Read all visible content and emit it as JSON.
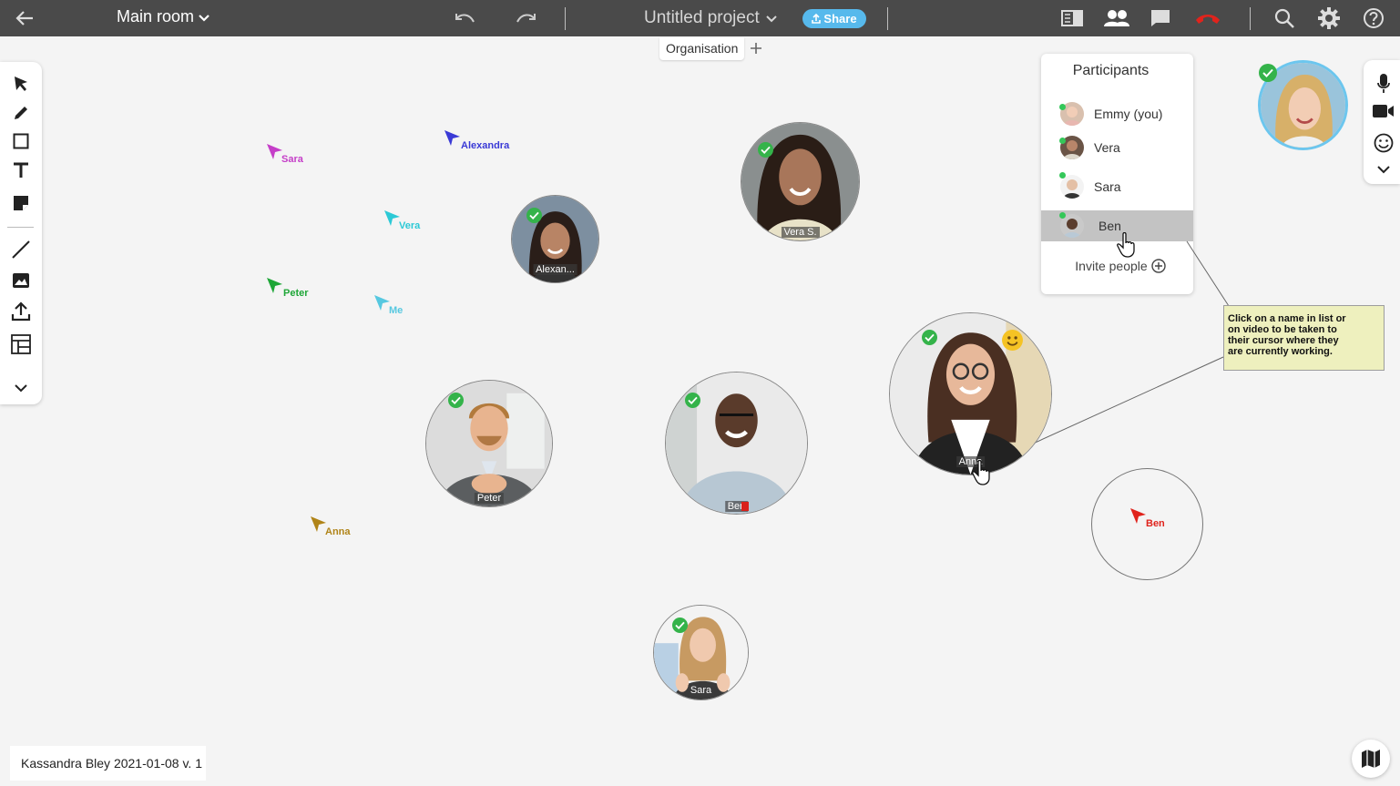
{
  "topbar": {
    "room_title": "Main room",
    "project_title": "Untitled project",
    "share_label": "Share"
  },
  "tabs": [
    {
      "label": "Organisation"
    }
  ],
  "tools": [
    "select-tool",
    "pen-tool",
    "rectangle-tool",
    "text-tool",
    "sticky-note-tool",
    "line-tool",
    "image-tool",
    "upload-tool",
    "template-tool",
    "more-tools"
  ],
  "participants_panel": {
    "title": "Participants",
    "participants": [
      {
        "name": "Emmy (you)",
        "online": true
      },
      {
        "name": "Vera",
        "online": true
      },
      {
        "name": "Sara",
        "online": true
      },
      {
        "name": "Ben",
        "online": true,
        "highlighted": true
      }
    ],
    "invite_label": "Invite people"
  },
  "cursors": [
    {
      "name": "Sara",
      "color": "#c53ec8"
    },
    {
      "name": "Alexandra",
      "color": "#3a3ad6"
    },
    {
      "name": "Vera",
      "color": "#2cc9d6"
    },
    {
      "name": "Peter",
      "color": "#1ea637"
    },
    {
      "name": "Me",
      "color": "#56c8e0"
    },
    {
      "name": "Anna",
      "color": "#b08418"
    },
    {
      "name": "Ben",
      "color": "#e0231c"
    }
  ],
  "videos": [
    {
      "label": "Alexan...",
      "verified": true
    },
    {
      "label": "Vera S.",
      "verified": true
    },
    {
      "label": "Peter",
      "verified": true
    },
    {
      "label": "Ben",
      "verified": true,
      "muted": true
    },
    {
      "label": "Anna",
      "verified": true,
      "emoji": "smile"
    },
    {
      "label": "Sara",
      "verified": true
    }
  ],
  "self_video": {
    "verified": true
  },
  "tooltip": {
    "lines": [
      "Click on a name in list or",
      "on video to be taken to",
      "their cursor where they",
      "are currently working."
    ]
  },
  "footer": {
    "label": "Kassandra Bley 2021-01-08 v. 1"
  },
  "colors": {
    "topbar_bg": "#4a4a4a",
    "share_button": "#57b9ec",
    "online_status": "#34c759",
    "verified_check": "#34b34a",
    "hangup": "#e0231c",
    "tooltip_bg": "#eef0be"
  }
}
